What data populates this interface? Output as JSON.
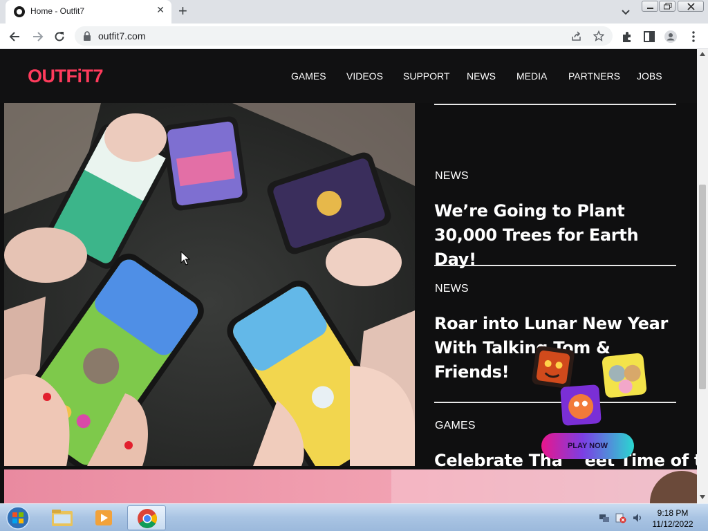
{
  "browser": {
    "tab_title": "Home - Outfit7",
    "url": "outfit7.com"
  },
  "site": {
    "logo": "OUTFiT7",
    "nav": [
      "GAMES",
      "VIDEOS",
      "SUPPORT",
      "NEWS",
      "MEDIA",
      "PARTNERS",
      "JOBS"
    ],
    "articles": [
      {
        "category": "NEWS",
        "title": "We’re Going to Plant 30,000 Trees for Earth Day!"
      },
      {
        "category": "NEWS",
        "title": "Roar into Lunar New Year With Talking Tom & Friends!"
      },
      {
        "category": "GAMES",
        "title": "Celebrate Tha    eet Time of the Year!"
      }
    ],
    "promo_button": "PLAY NOW"
  },
  "taskbar": {
    "time": "9:18 PM",
    "date": "11/12/2022"
  },
  "colors": {
    "brand": "#ff3b5c",
    "page_bg": "#0f0f10"
  }
}
